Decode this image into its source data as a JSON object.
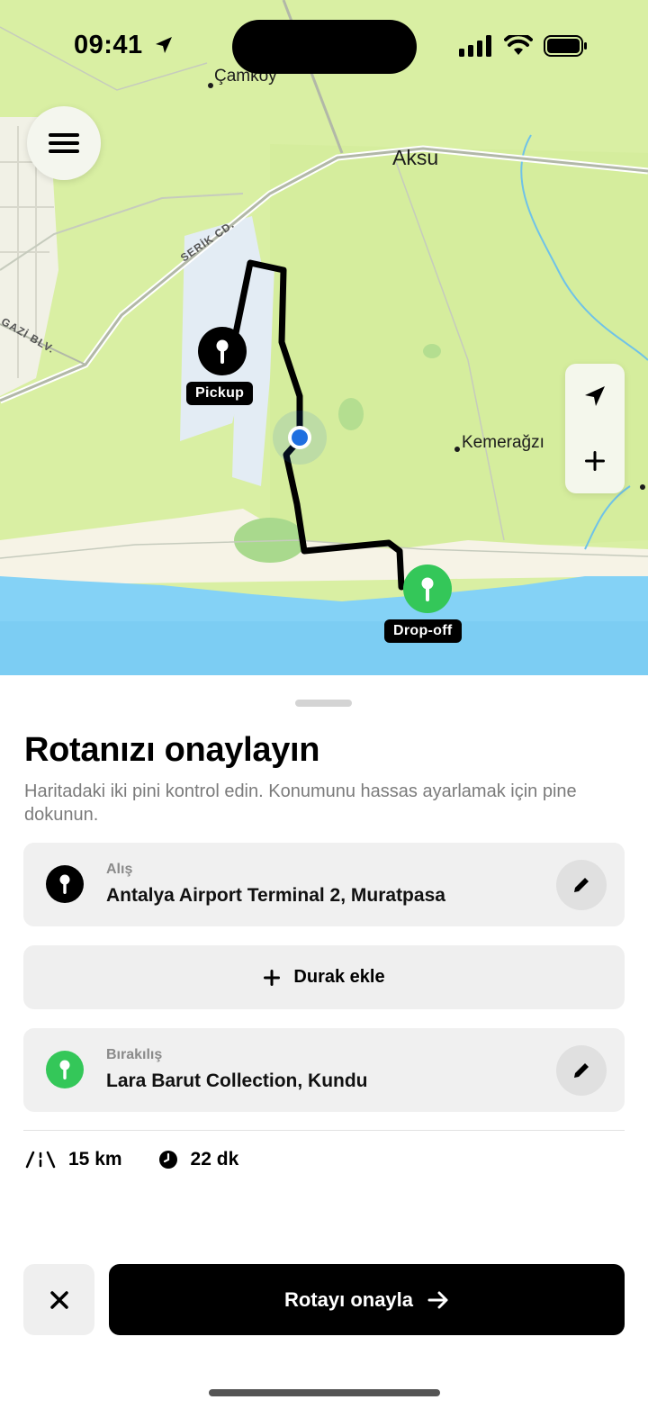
{
  "status_bar": {
    "time": "09:41"
  },
  "map": {
    "places": [
      {
        "name": "Çamköy"
      },
      {
        "name": "Aksu"
      },
      {
        "name": "Kemerağzı"
      }
    ],
    "roads": [
      "SERİK CD.",
      "GAZİ BLV."
    ],
    "pins": {
      "pickup_label": "Pickup",
      "dropoff_label": "Drop-off"
    },
    "colors": {
      "land": "#dcf0a6",
      "sea": "#84d2f6",
      "route": "#000000",
      "dropoff": "#34c759",
      "location": "#1f6fe0"
    }
  },
  "sheet": {
    "title": "Rotanızı onaylayın",
    "subtitle": "Haritadaki iki pini kontrol edin. Konumunu hassas ayarlamak için pine dokunun.",
    "pickup": {
      "label": "Alış",
      "address": "Antalya Airport Terminal 2, Muratpasa"
    },
    "add_stop": "Durak ekle",
    "dropoff": {
      "label": "Bırakılış",
      "address": "Lara Barut Collection, Kundu"
    },
    "stats": {
      "distance": "15 km",
      "duration": "22 dk"
    },
    "confirm": "Rotayı onayla"
  },
  "icons": [
    "menu-icon",
    "navigation-arrow-icon",
    "plus-icon",
    "pin-icon",
    "pencil-icon",
    "road-icon",
    "clock-icon",
    "close-icon",
    "arrow-right-icon"
  ]
}
